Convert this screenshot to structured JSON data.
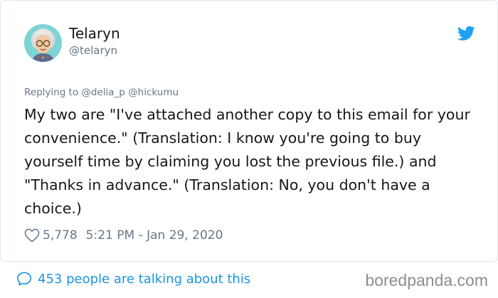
{
  "tweet": {
    "display_name": "Telaryn",
    "handle": "@telaryn",
    "reply_prefix": "Replying to",
    "reply_to": "@delia_p @hickumu",
    "text": "My two are \"I've attached another copy to this email for your convenience.\" (Translation: I know you're going to buy yourself time by claiming you lost the previous file.) and \"Thanks in advance.\" (Translation: No, you don't have a choice.)",
    "likes": "5,778",
    "timestamp": "5:21 PM - Jan 29, 2020"
  },
  "footer": {
    "talking": "453 people are talking about this",
    "watermark": "boredpanda.com"
  },
  "icons": {
    "platform": "twitter-bird-icon",
    "like": "heart-icon",
    "comments": "speech-bubble-icon"
  },
  "colors": {
    "brand_blue": "#1da1f2",
    "link_blue": "#1b95e0",
    "muted_gray": "#657786",
    "text": "#14171a",
    "avatar_bg": "#7ed3d6"
  }
}
